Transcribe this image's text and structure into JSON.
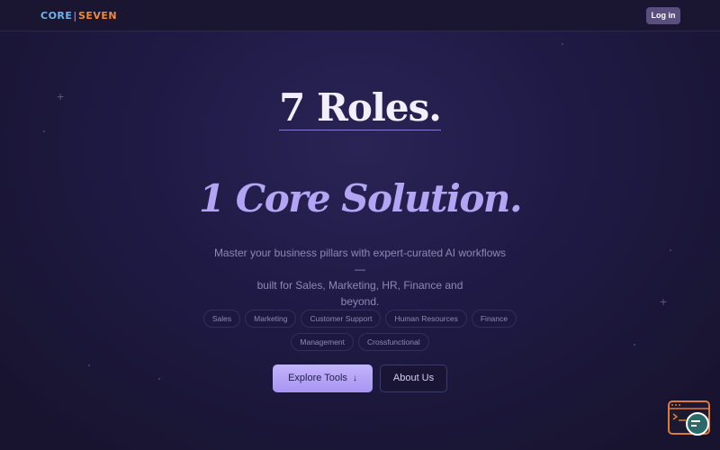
{
  "brand": {
    "logo_left": "CORE",
    "logo_sep": "|",
    "logo_right": "SEVEN",
    "colors": {
      "left": "#6fb4e8",
      "right": "#f08a3c"
    }
  },
  "nav": {
    "login_label": "Log in"
  },
  "hero": {
    "headline_1": "7 Roles.",
    "headline_2": "1 Core Solution.",
    "subtitle_line_1": "Master your business pillars with expert-curated AI workflows —",
    "subtitle_line_2": "built for Sales, Marketing, HR, Finance and",
    "subtitle_line_3": "beyond."
  },
  "roles": [
    "Sales",
    "Marketing",
    "Customer Support",
    "Human Resources",
    "Finance",
    "Management",
    "Crossfunctional"
  ],
  "actions": {
    "explore_label": "Explore Tools",
    "explore_icon": "arrow-down-icon",
    "about_label": "About Us"
  },
  "widget": {
    "icon": "support-chat-widget-icon"
  },
  "colors": {
    "background": "#1f1a45",
    "accent": "#b4a4f4",
    "button_primary": "#b7a7f8"
  }
}
